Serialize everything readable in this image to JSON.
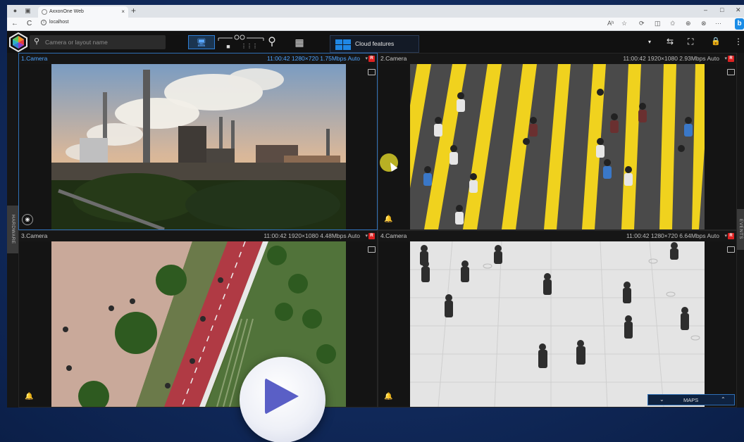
{
  "browser": {
    "tab_title": "AxxonOne Web",
    "url": "localhost",
    "info_glyph": "i",
    "tab_close": "×",
    "new_tab": "+",
    "window_controls": [
      "–",
      "□",
      "✕"
    ],
    "nav": {
      "back": "←",
      "reload": "C"
    },
    "toolbar_icons": [
      "Aʰ",
      "☆",
      "⟳",
      "◫",
      "✩",
      "⊕",
      "⊗",
      "···"
    ],
    "bing_label": "b"
  },
  "app": {
    "search_placeholder": "Camera or layout name",
    "search_glyph": "⚲",
    "toolbar_glyphs": {
      "monitor": "🖥",
      "camera": "■",
      "grid": "⋮⋮⋮",
      "search": "⚲",
      "layouts": "▦"
    },
    "cloud_label": "Cloud features",
    "right_tools": [
      "▾",
      "⇆",
      "⛶",
      "🔒",
      "⋮"
    ],
    "side_tabs": {
      "left": "HARDWARE",
      "right": "EVENTS"
    },
    "maps_label": "MAPS",
    "maps_glyphs": {
      "down": "⌄",
      "up": "⌃"
    },
    "accent": "#2f7fd6"
  },
  "cameras": [
    {
      "name": "1.Camera",
      "info": "11:00:42  1280×720 1.75Mbps Auto",
      "badge": "R",
      "dropdown": "▾",
      "selected": true,
      "scene": "industrial-plant"
    },
    {
      "name": "2.Camera",
      "info": "11:00:42  1920×1080 2.93Mbps Auto",
      "badge": "R",
      "dropdown": "▾",
      "selected": false,
      "scene": "crosswalk"
    },
    {
      "name": "3.Camera",
      "info": "11:00:42  1920×1080 4.48Mbps Auto",
      "badge": "R",
      "dropdown": "▾",
      "selected": false,
      "scene": "bike-path"
    },
    {
      "name": "4.Camera",
      "info": "11:00:42  1280×720 6.64Mbps Auto",
      "badge": "R",
      "dropdown": "▾",
      "selected": false,
      "scene": "plaza"
    }
  ]
}
